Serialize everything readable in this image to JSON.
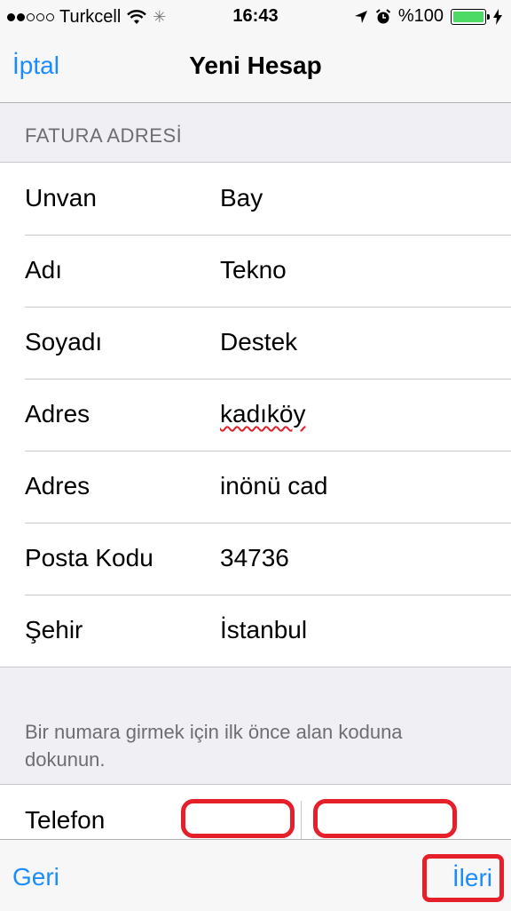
{
  "status_bar": {
    "carrier": "Turkcell",
    "time": "16:43",
    "battery": "%100",
    "signal_bars_filled": 2,
    "signal_bars_total": 5
  },
  "nav": {
    "cancel_label": "İptal",
    "title": "Yeni Hesap"
  },
  "section": {
    "header": "FATURA ADRESİ"
  },
  "form": {
    "rows": [
      {
        "label": "Unvan",
        "value": "Bay"
      },
      {
        "label": "Adı",
        "value": "Tekno"
      },
      {
        "label": "Soyadı",
        "value": "Destek"
      },
      {
        "label": "Adres",
        "value": "kadıköy"
      },
      {
        "label": "Adres",
        "value": "inönü cad"
      },
      {
        "label": "Posta Kodu",
        "value": "34736"
      },
      {
        "label": "Şehir",
        "value": "İstanbul"
      }
    ]
  },
  "phone": {
    "hint": "Bir numara girmek için ilk önce alan koduna dokunun.",
    "label": "Telefon",
    "area_code": "",
    "number": ""
  },
  "toolbar": {
    "back_label": "Geri",
    "next_label": "İleri"
  },
  "colors": {
    "accent": "#1a8cff",
    "highlight": "#e5202a",
    "battery": "#4cd964"
  }
}
